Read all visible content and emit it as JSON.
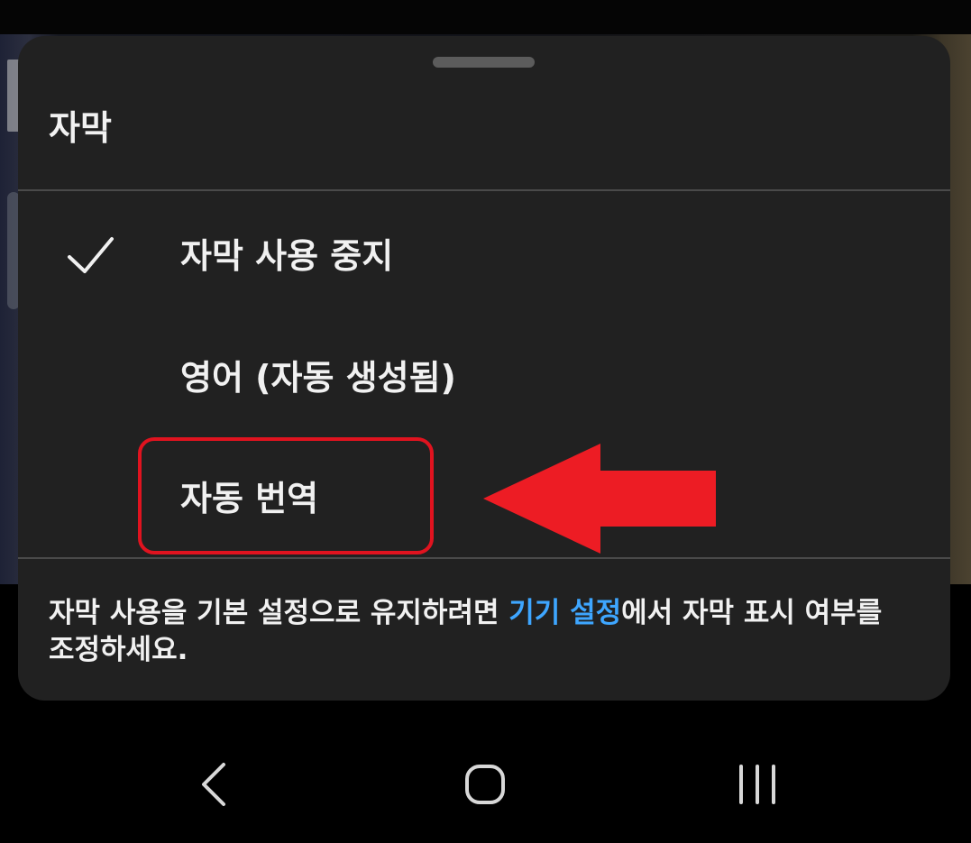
{
  "sheet": {
    "title": "자막",
    "options": [
      {
        "label": "자막 사용 중지",
        "selected": true
      },
      {
        "label": "영어 (자동 생성됨)",
        "selected": false
      },
      {
        "label": "자동 번역",
        "selected": false
      }
    ],
    "footer": {
      "prefix": "자막 사용을 기본 설정으로 유지하려면 ",
      "link": "기기 설정",
      "suffix": "에서 자막 표시 여부를 조정하세요."
    }
  },
  "annotation": {
    "highlight_color": "#e0131f",
    "arrow_color": "#ed1c24"
  },
  "colors": {
    "sheet_bg": "#212121",
    "text": "#f1f1f1",
    "link": "#3ea6ff"
  },
  "icons": {
    "check": "check-icon",
    "back": "chevron-left-icon",
    "home": "home-icon",
    "recent": "recent-apps-icon"
  }
}
